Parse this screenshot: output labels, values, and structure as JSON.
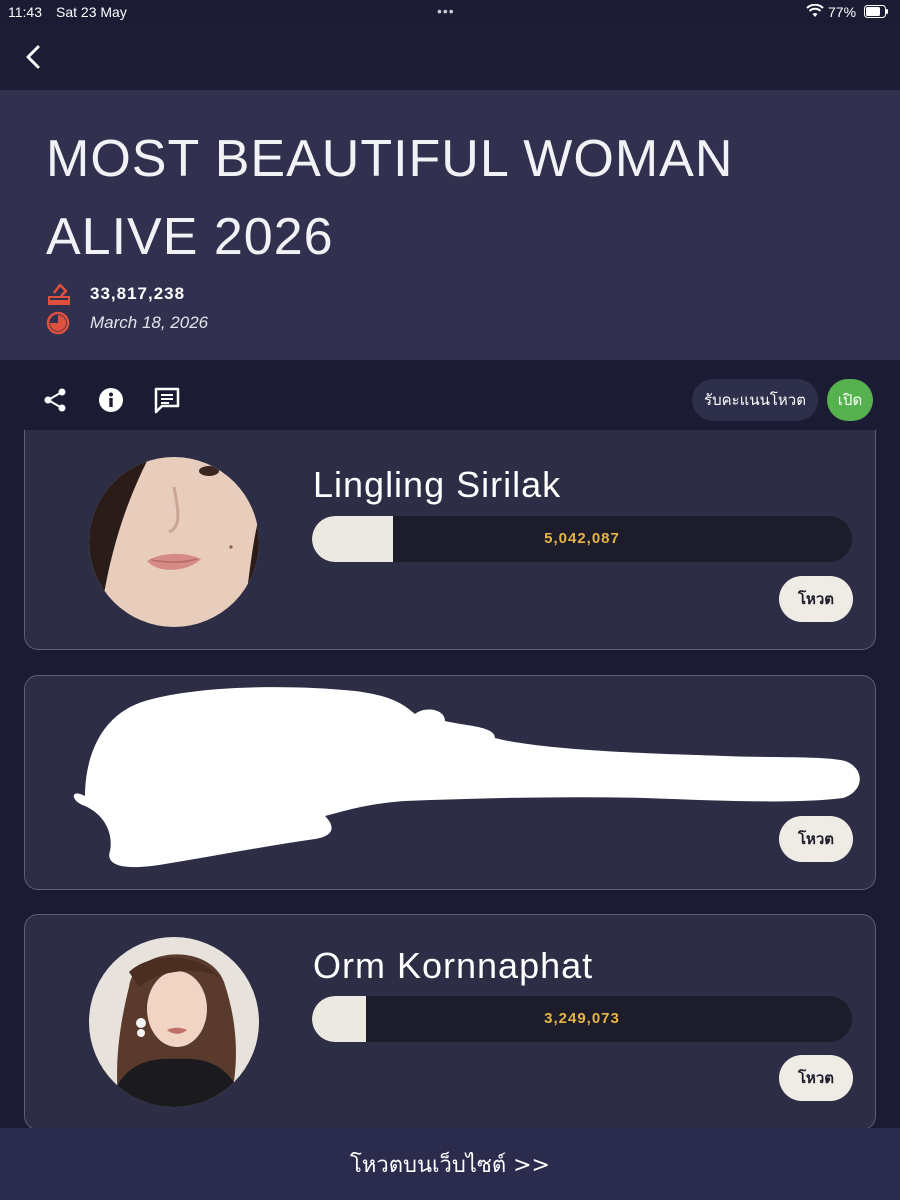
{
  "status_bar": {
    "time": "11:43",
    "date": "Sat 23 May",
    "battery_percent": "77%"
  },
  "poll": {
    "title": "MOST BEAUTIFUL WOMAN ALIVE 2026",
    "total_votes": "33,817,238",
    "date": "March 18, 2026"
  },
  "actions": {
    "vote_toggle_label": "รับคะแนนโหวต",
    "open_label": "เปิด"
  },
  "candidates": [
    {
      "name": "Lingling Sirilak",
      "votes": "5,042,087",
      "vote_label": "โหวต",
      "bar_fill": 0.15
    },
    {
      "name": "",
      "votes": "",
      "vote_label": "โหวต",
      "redacted": true
    },
    {
      "name": "Orm Kornnaphat",
      "votes": "3,249,073",
      "vote_label": "โหวต",
      "bar_fill": 0.1
    }
  ],
  "footer": {
    "label": "โหวตบนเว็บไซต์ >>"
  },
  "colors": {
    "background": "#1b1c33",
    "hero": "#31314f",
    "card": "#2d2d45",
    "accent_red": "#e0503f",
    "vote_count_gold": "#e6b545",
    "open_green": "#55b24e"
  }
}
